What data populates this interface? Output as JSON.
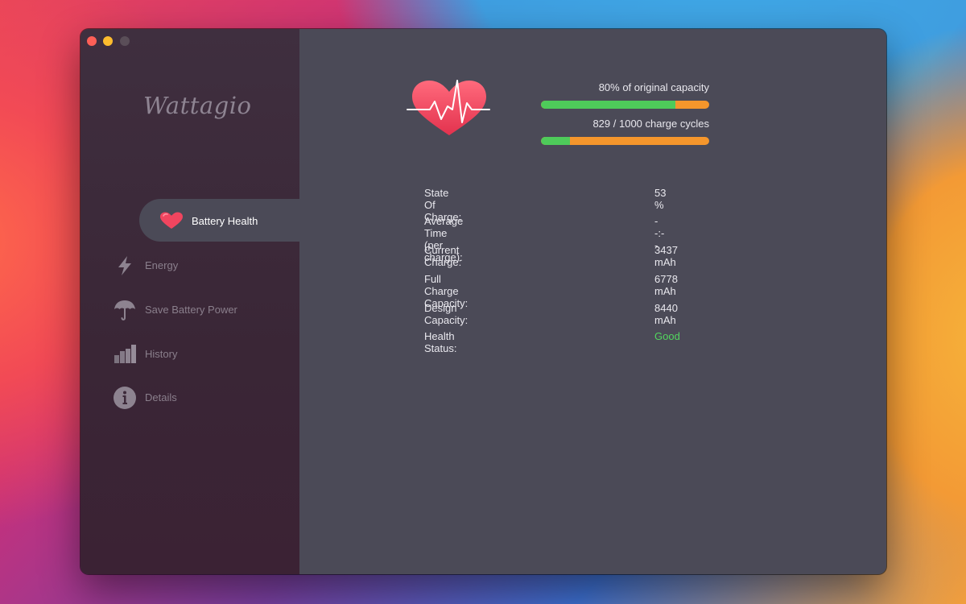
{
  "app": {
    "name": "Wattagio"
  },
  "window_controls": {
    "close": "close",
    "minimize": "minimize",
    "zoom": "zoom"
  },
  "sidebar": {
    "items": [
      {
        "label": "Battery Health",
        "icon": "heart-icon",
        "active": true
      },
      {
        "label": "Energy",
        "icon": "lightning-icon",
        "active": false
      },
      {
        "label": "Save Battery Power",
        "icon": "umbrella-icon",
        "active": false
      },
      {
        "label": "History",
        "icon": "bar-chart-icon",
        "active": false
      },
      {
        "label": "Details",
        "icon": "info-icon",
        "active": false
      }
    ]
  },
  "summary": {
    "capacity_label": "80% of original capacity",
    "capacity_fraction": 0.8,
    "cycles_label": "829 / 1000 charge cycles",
    "cycles_fraction": 0.17
  },
  "stats": [
    {
      "label": "State Of Charge:",
      "value": "53 %"
    },
    {
      "label": "Average Time (per charge):",
      "value": "--:--"
    },
    {
      "label": "Current Charge:",
      "value": "3437 mAh"
    },
    {
      "label": "Full Charge Capacity:",
      "value": "6778 mAh"
    },
    {
      "label": "Design Capacity:",
      "value": "8440 mAh"
    },
    {
      "label": "Health Status:",
      "value": "Good"
    }
  ],
  "colors": {
    "good": "#52d65e",
    "bar_fill": "#4ecb5a",
    "bar_remaining": "#f5962c",
    "accent_heart": "#f0455f"
  }
}
